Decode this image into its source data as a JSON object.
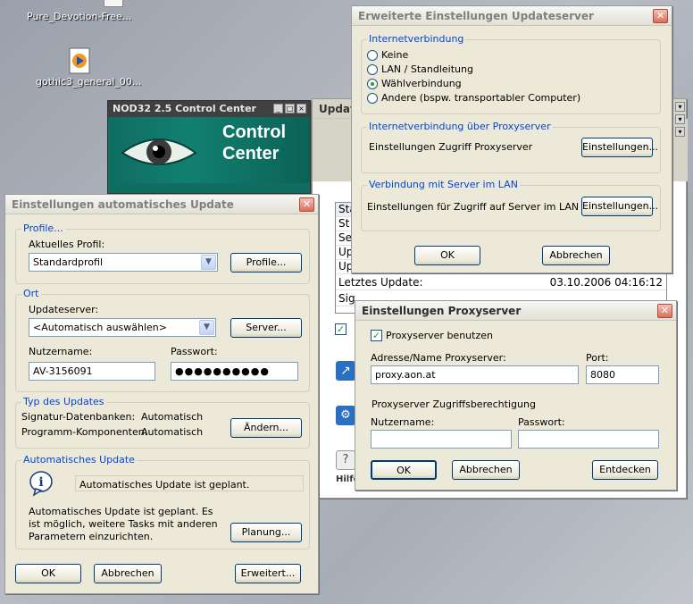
{
  "desktop": {
    "icons": [
      {
        "label": "Pure_Devotion-Free..."
      },
      {
        "label": "gothic3_general_00..."
      }
    ]
  },
  "nod": {
    "title": "NOD32 2.5 Control Center",
    "banner_line1": "Control",
    "banner_line2": "Center"
  },
  "update_panel": {
    "title_partial": "Updat",
    "rows": [
      "Sta",
      "St",
      "Se",
      "Up",
      "Up",
      "Letztes Update:",
      "Sig"
    ],
    "last_update_label": "Letztes Update:",
    "last_update_value": "03.10.2006 04:16:12",
    "help_label": "Hilfe"
  },
  "auto_update": {
    "title": "Einstellungen automatisches Update",
    "profile_group": "Profile...",
    "current_profile_label": "Aktuelles Profil:",
    "current_profile_value": "Standardprofil",
    "profiles_button": "Profile...",
    "ort_group": "Ort",
    "updateserver_label": "Updateserver:",
    "updateserver_value": "<Automatisch auswählen>",
    "server_button": "Server...",
    "username_label": "Nutzername:",
    "username_value": "AV-3156091",
    "password_label": "Passwort:",
    "password_value": "●●●●●●●●●●",
    "type_group": "Typ des Updates",
    "signature_label": "Signatur-Datenbanken:",
    "signature_value": "Automatisch",
    "program_label": "Programm-Komponenten:",
    "program_value": "Automatisch",
    "change_button": "Ändern...",
    "auto_group": "Automatisches Update",
    "auto_status": "Automatisches Update ist geplant.",
    "auto_desc": "Automatisches Update ist geplant. Es ist möglich, weitere Tasks mit anderen Parametern einzurichten.",
    "planning_button": "Planung...",
    "ok_button": "OK",
    "cancel_button": "Abbrechen",
    "advanced_button": "Erweitert..."
  },
  "ext_settings": {
    "title": "Erweiterte Einstellungen Updateserver",
    "inet_group": "Internetverbindung",
    "options": [
      "Keine",
      "LAN / Standleitung",
      "Wählverbindung",
      "Andere (bspw. transportabler Computer)"
    ],
    "selected_option": "Wählverbindung",
    "proxy_group": "Internetverbindung über Proxyserver",
    "proxy_label": "Einstellungen Zugriff Proxyserver",
    "proxy_button": "Einstellungen...",
    "lan_group": "Verbindung mit Server im LAN",
    "lan_label": "Einstellungen für Zugriff auf Server im LAN",
    "lan_button": "Einstellungen...",
    "ok_button": "OK",
    "cancel_button": "Abbrechen"
  },
  "proxy": {
    "title": "Einstellungen Proxyserver",
    "use_proxy_label": "Proxyserver benutzen",
    "use_proxy_checked": true,
    "address_label": "Adresse/Name Proxyserver:",
    "address_value": "proxy.aon.at",
    "port_label": "Port:",
    "port_value": "8080",
    "auth_label": "Proxyserver Zugriffsberechtigung",
    "username_label": "Nutzername:",
    "username_value": "",
    "password_label": "Passwort:",
    "password_value": "",
    "ok_button": "OK",
    "cancel_button": "Abbrechen",
    "detect_button": "Entdecken"
  },
  "colors": {
    "group_label": "#0046d5",
    "nod_banner": "#11806f",
    "xp_face": "#ece9d8"
  }
}
